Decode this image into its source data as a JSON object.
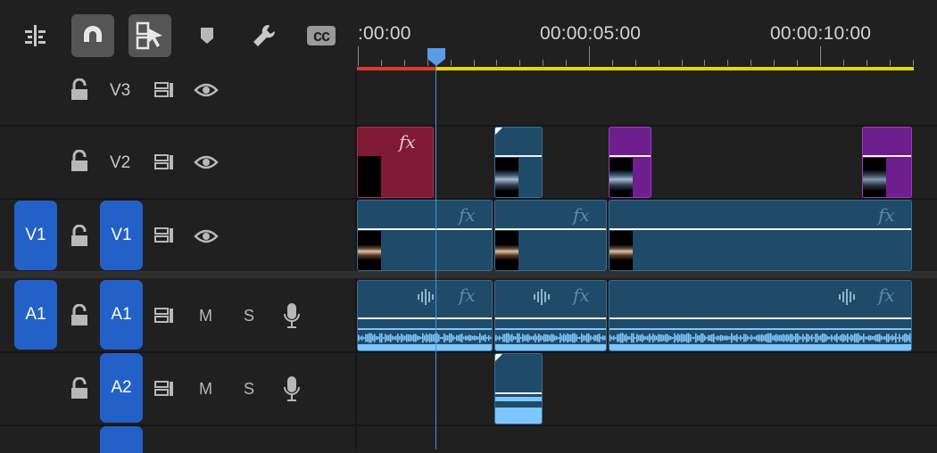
{
  "toolbar": {
    "items": [
      {
        "icon": "insert-edit-icon"
      },
      {
        "icon": "snap-magnet-icon",
        "active": true
      },
      {
        "icon": "linked-selection-icon",
        "active": true
      },
      {
        "icon": "add-marker-icon"
      },
      {
        "icon": "wrench-settings-icon"
      },
      {
        "icon": "captions-icon",
        "text": "cc"
      }
    ]
  },
  "ruler": {
    "timecodes": [
      ":00:00",
      "00:00:05:00",
      "00:00:10:00"
    ]
  },
  "tracks": {
    "v3": {
      "label": "V3"
    },
    "v2": {
      "label": "V2"
    },
    "v1": {
      "source_patch": "V1",
      "label": "V1"
    },
    "a1": {
      "source_patch": "A1",
      "label": "A1",
      "mute": "M",
      "solo": "S"
    },
    "a2": {
      "label": "A2",
      "mute": "M",
      "solo": "S"
    }
  },
  "clips": {
    "fx_label": "fx"
  },
  "colors": {
    "background": "#202020",
    "patch_blue": "#2361c8",
    "clip_blue": "#1f4a68",
    "clip_red": "#7f1a35",
    "clip_purple": "#6f1e8e",
    "playhead": "#4a90e2",
    "work_area": "#e5d800",
    "rendered": "#e03a2a"
  }
}
